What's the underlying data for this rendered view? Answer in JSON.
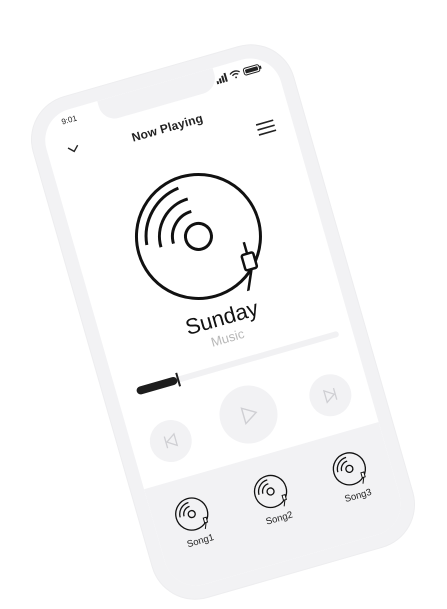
{
  "status_bar": {
    "time": "9:01"
  },
  "header": {
    "title": "Now Playing"
  },
  "track": {
    "title": "Sunday",
    "subtitle": "Music",
    "progress_fraction": 0.2
  },
  "controls": {
    "prev_icon": "previous-icon",
    "play_icon": "play-icon",
    "next_icon": "next-icon"
  },
  "playlist": {
    "items": [
      {
        "label": "Song1",
        "icon": "vinyl-record-icon"
      },
      {
        "label": "Song2",
        "icon": "vinyl-record-icon"
      },
      {
        "label": "Song3",
        "icon": "vinyl-record-icon"
      }
    ]
  },
  "colors": {
    "frame": "#f2f2f4",
    "accent": "#1d1d1d",
    "muted": "#b8b8b8"
  }
}
